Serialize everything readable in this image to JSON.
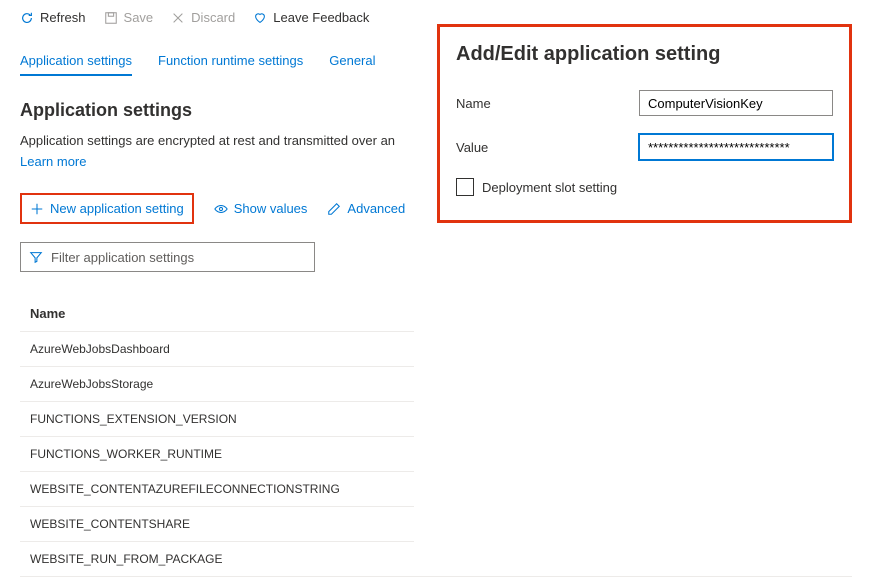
{
  "toolbar": {
    "refresh": "Refresh",
    "save": "Save",
    "discard": "Discard",
    "feedback": "Leave Feedback"
  },
  "tabs": {
    "app_settings": "Application settings",
    "runtime_settings": "Function runtime settings",
    "general": "General"
  },
  "section": {
    "title": "Application settings",
    "desc": "Application settings are encrypted at rest and transmitted over an",
    "learn_more": "Learn more"
  },
  "actions": {
    "new_setting": "New application setting",
    "show_values": "Show values",
    "advanced": "Advanced"
  },
  "filter": {
    "placeholder": "Filter application settings"
  },
  "table": {
    "header_name": "Name",
    "rows": [
      "AzureWebJobsDashboard",
      "AzureWebJobsStorage",
      "FUNCTIONS_EXTENSION_VERSION",
      "FUNCTIONS_WORKER_RUNTIME",
      "WEBSITE_CONTENTAZUREFILECONNECTIONSTRING",
      "WEBSITE_CONTENTSHARE",
      "WEBSITE_RUN_FROM_PACKAGE"
    ]
  },
  "panel": {
    "title": "Add/Edit application setting",
    "name_label": "Name",
    "name_value": "ComputerVisionKey",
    "value_label": "Value",
    "value_value": "****************************",
    "deployment_slot": "Deployment slot setting"
  }
}
